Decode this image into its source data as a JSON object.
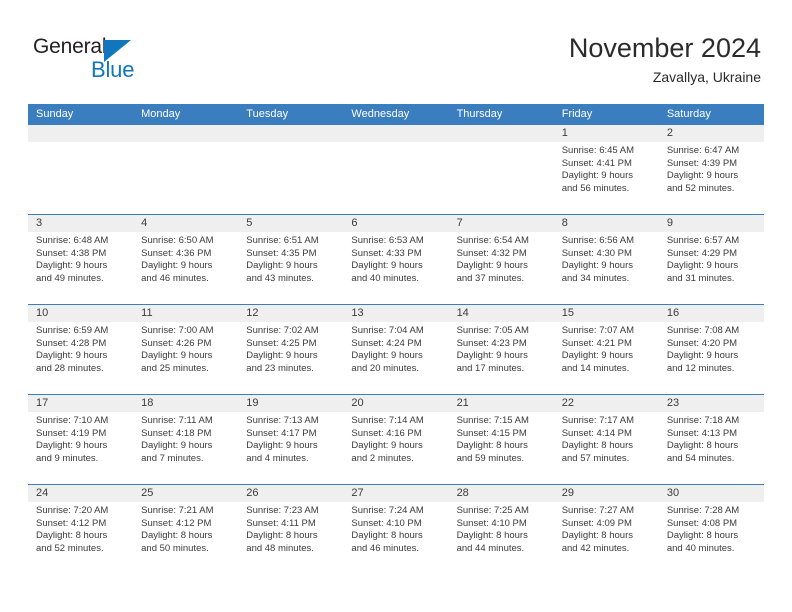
{
  "brand": {
    "name_top": "General",
    "name_bottom": "Blue",
    "triangle_color": "#1176bc",
    "top_color": "#231f20"
  },
  "header": {
    "title": "November 2024",
    "subtitle": "Zavallya, Ukraine"
  },
  "colors": {
    "header_blue": "#3a7ebf",
    "daynum_band": "#efefef",
    "text": "#3b3b3b",
    "page_background": "#ffffff"
  },
  "weekdays": [
    "Sunday",
    "Monday",
    "Tuesday",
    "Wednesday",
    "Thursday",
    "Friday",
    "Saturday"
  ],
  "weeks": [
    [
      {
        "day": "",
        "lines": []
      },
      {
        "day": "",
        "lines": []
      },
      {
        "day": "",
        "lines": []
      },
      {
        "day": "",
        "lines": []
      },
      {
        "day": "",
        "lines": []
      },
      {
        "day": "1",
        "lines": [
          "Sunrise: 6:45 AM",
          "Sunset: 4:41 PM",
          "Daylight: 9 hours",
          "and 56 minutes."
        ]
      },
      {
        "day": "2",
        "lines": [
          "Sunrise: 6:47 AM",
          "Sunset: 4:39 PM",
          "Daylight: 9 hours",
          "and 52 minutes."
        ]
      }
    ],
    [
      {
        "day": "3",
        "lines": [
          "Sunrise: 6:48 AM",
          "Sunset: 4:38 PM",
          "Daylight: 9 hours",
          "and 49 minutes."
        ]
      },
      {
        "day": "4",
        "lines": [
          "Sunrise: 6:50 AM",
          "Sunset: 4:36 PM",
          "Daylight: 9 hours",
          "and 46 minutes."
        ]
      },
      {
        "day": "5",
        "lines": [
          "Sunrise: 6:51 AM",
          "Sunset: 4:35 PM",
          "Daylight: 9 hours",
          "and 43 minutes."
        ]
      },
      {
        "day": "6",
        "lines": [
          "Sunrise: 6:53 AM",
          "Sunset: 4:33 PM",
          "Daylight: 9 hours",
          "and 40 minutes."
        ]
      },
      {
        "day": "7",
        "lines": [
          "Sunrise: 6:54 AM",
          "Sunset: 4:32 PM",
          "Daylight: 9 hours",
          "and 37 minutes."
        ]
      },
      {
        "day": "8",
        "lines": [
          "Sunrise: 6:56 AM",
          "Sunset: 4:30 PM",
          "Daylight: 9 hours",
          "and 34 minutes."
        ]
      },
      {
        "day": "9",
        "lines": [
          "Sunrise: 6:57 AM",
          "Sunset: 4:29 PM",
          "Daylight: 9 hours",
          "and 31 minutes."
        ]
      }
    ],
    [
      {
        "day": "10",
        "lines": [
          "Sunrise: 6:59 AM",
          "Sunset: 4:28 PM",
          "Daylight: 9 hours",
          "and 28 minutes."
        ]
      },
      {
        "day": "11",
        "lines": [
          "Sunrise: 7:00 AM",
          "Sunset: 4:26 PM",
          "Daylight: 9 hours",
          "and 25 minutes."
        ]
      },
      {
        "day": "12",
        "lines": [
          "Sunrise: 7:02 AM",
          "Sunset: 4:25 PM",
          "Daylight: 9 hours",
          "and 23 minutes."
        ]
      },
      {
        "day": "13",
        "lines": [
          "Sunrise: 7:04 AM",
          "Sunset: 4:24 PM",
          "Daylight: 9 hours",
          "and 20 minutes."
        ]
      },
      {
        "day": "14",
        "lines": [
          "Sunrise: 7:05 AM",
          "Sunset: 4:23 PM",
          "Daylight: 9 hours",
          "and 17 minutes."
        ]
      },
      {
        "day": "15",
        "lines": [
          "Sunrise: 7:07 AM",
          "Sunset: 4:21 PM",
          "Daylight: 9 hours",
          "and 14 minutes."
        ]
      },
      {
        "day": "16",
        "lines": [
          "Sunrise: 7:08 AM",
          "Sunset: 4:20 PM",
          "Daylight: 9 hours",
          "and 12 minutes."
        ]
      }
    ],
    [
      {
        "day": "17",
        "lines": [
          "Sunrise: 7:10 AM",
          "Sunset: 4:19 PM",
          "Daylight: 9 hours",
          "and 9 minutes."
        ]
      },
      {
        "day": "18",
        "lines": [
          "Sunrise: 7:11 AM",
          "Sunset: 4:18 PM",
          "Daylight: 9 hours",
          "and 7 minutes."
        ]
      },
      {
        "day": "19",
        "lines": [
          "Sunrise: 7:13 AM",
          "Sunset: 4:17 PM",
          "Daylight: 9 hours",
          "and 4 minutes."
        ]
      },
      {
        "day": "20",
        "lines": [
          "Sunrise: 7:14 AM",
          "Sunset: 4:16 PM",
          "Daylight: 9 hours",
          "and 2 minutes."
        ]
      },
      {
        "day": "21",
        "lines": [
          "Sunrise: 7:15 AM",
          "Sunset: 4:15 PM",
          "Daylight: 8 hours",
          "and 59 minutes."
        ]
      },
      {
        "day": "22",
        "lines": [
          "Sunrise: 7:17 AM",
          "Sunset: 4:14 PM",
          "Daylight: 8 hours",
          "and 57 minutes."
        ]
      },
      {
        "day": "23",
        "lines": [
          "Sunrise: 7:18 AM",
          "Sunset: 4:13 PM",
          "Daylight: 8 hours",
          "and 54 minutes."
        ]
      }
    ],
    [
      {
        "day": "24",
        "lines": [
          "Sunrise: 7:20 AM",
          "Sunset: 4:12 PM",
          "Daylight: 8 hours",
          "and 52 minutes."
        ]
      },
      {
        "day": "25",
        "lines": [
          "Sunrise: 7:21 AM",
          "Sunset: 4:12 PM",
          "Daylight: 8 hours",
          "and 50 minutes."
        ]
      },
      {
        "day": "26",
        "lines": [
          "Sunrise: 7:23 AM",
          "Sunset: 4:11 PM",
          "Daylight: 8 hours",
          "and 48 minutes."
        ]
      },
      {
        "day": "27",
        "lines": [
          "Sunrise: 7:24 AM",
          "Sunset: 4:10 PM",
          "Daylight: 8 hours",
          "and 46 minutes."
        ]
      },
      {
        "day": "28",
        "lines": [
          "Sunrise: 7:25 AM",
          "Sunset: 4:10 PM",
          "Daylight: 8 hours",
          "and 44 minutes."
        ]
      },
      {
        "day": "29",
        "lines": [
          "Sunrise: 7:27 AM",
          "Sunset: 4:09 PM",
          "Daylight: 8 hours",
          "and 42 minutes."
        ]
      },
      {
        "day": "30",
        "lines": [
          "Sunrise: 7:28 AM",
          "Sunset: 4:08 PM",
          "Daylight: 8 hours",
          "and 40 minutes."
        ]
      }
    ]
  ]
}
